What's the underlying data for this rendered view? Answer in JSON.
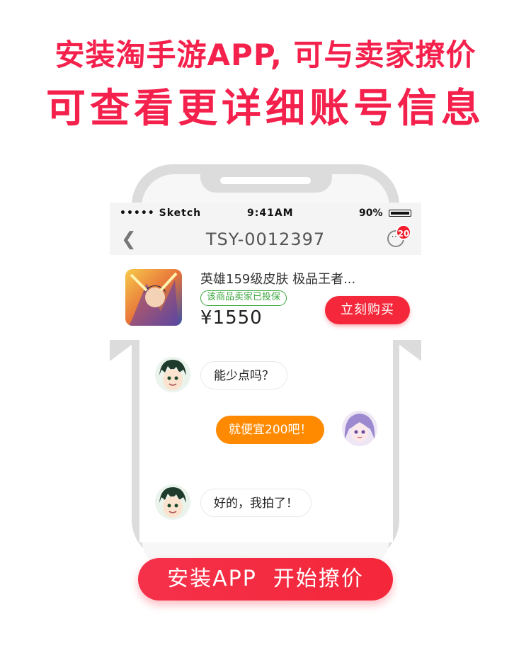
{
  "headline": {
    "line1": "安装淘手游APP, 可与卖家撩价",
    "line2": "可查看更详细账号信息"
  },
  "statusbar": {
    "carrier": "••••• Sketch",
    "time": "9:41AM",
    "battery": "90%"
  },
  "navbar": {
    "title": "TSY-0012397",
    "badge_count": "20"
  },
  "product": {
    "title": "英雄159级皮肤 极品王者...",
    "tag": "该商品卖家已投保",
    "price": "¥1550",
    "buy_label": "立刻购买"
  },
  "messages": [
    {
      "side": "left",
      "text": "能少点吗？"
    },
    {
      "side": "right",
      "text": "就便宜200吧！"
    },
    {
      "side": "left",
      "text": "好的，我拍了！"
    }
  ],
  "cta": {
    "label": "安装APP  开始撩价"
  },
  "colors": {
    "accent": "#f5214d",
    "buy": "#f4283a",
    "outgoing_bubble": "#ff8a00",
    "tag_green": "#3aa63d"
  },
  "icons": [
    "back-icon",
    "more-options-icon"
  ]
}
